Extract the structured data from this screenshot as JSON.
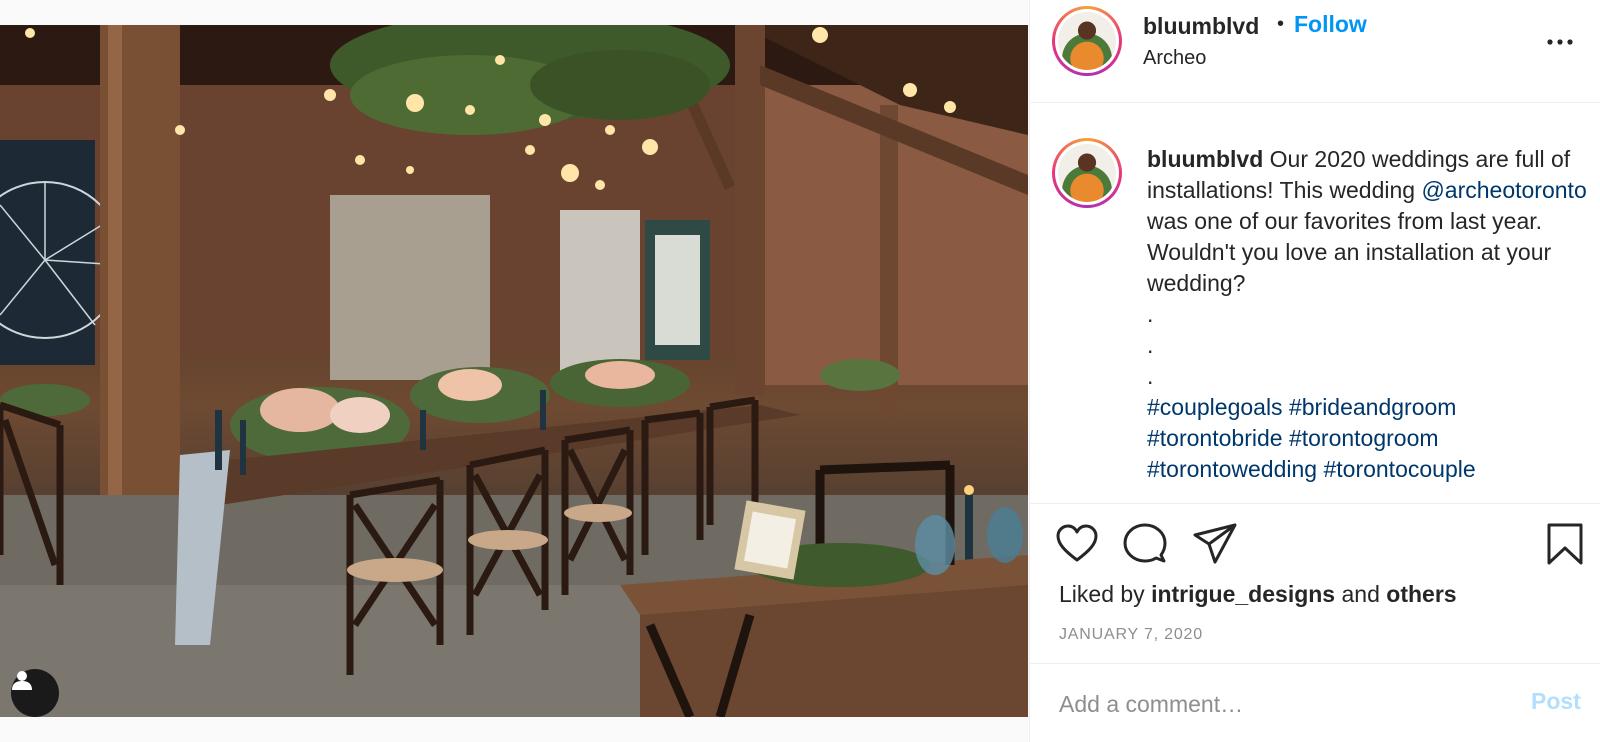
{
  "post": {
    "username": "bluumblvd",
    "separator": "•",
    "follow_label": "Follow",
    "location": "Archeo",
    "more_icon": "more-horizontal-icon"
  },
  "caption": {
    "username": "bluumblvd",
    "text": "Our 2020 weddings are full of installations! This wedding",
    "mention": "@archeotoronto",
    "text_after": "was one of our favorites from last year. Wouldn't you love an installation at your wedding?",
    "dots": [
      ".",
      ".",
      "."
    ],
    "hashtags_line1": [
      "#couplegoals",
      "#brideandgroom"
    ],
    "hashtags_line2": [
      "#torontobride",
      "#torontogroom"
    ],
    "hashtags_line3": [
      "#torontowedding",
      "#torontocouple"
    ]
  },
  "actions": {
    "like_icon": "heart-icon",
    "comment_icon": "comment-bubble-icon",
    "share_icon": "paper-plane-icon",
    "save_icon": "bookmark-icon"
  },
  "likes": {
    "prefix": "Liked by",
    "user": "intrigue_designs",
    "and": "and",
    "others": "others"
  },
  "date": "JANUARY 7, 2020",
  "comment": {
    "placeholder": "Add a comment…",
    "post_label": "Post"
  },
  "colors": {
    "follow": "#0095f6",
    "link": "#00376b",
    "muted": "#8e8e8e",
    "post_disabled": "#b2dffc"
  }
}
